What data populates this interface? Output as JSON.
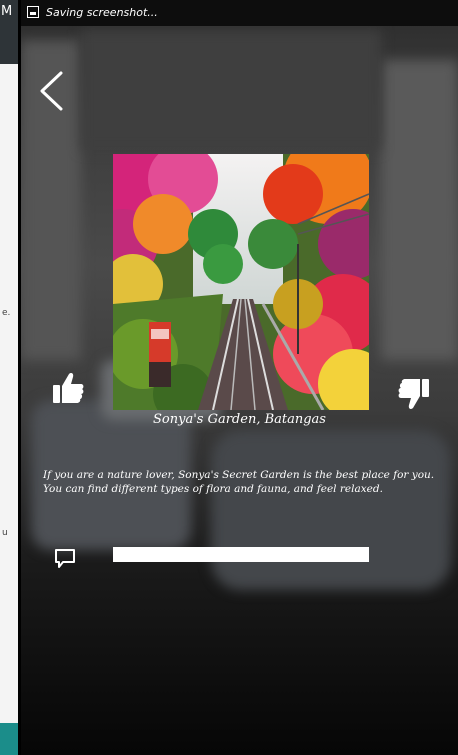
{
  "left_screen": {
    "top_letter": "M",
    "fragment_1": "e.",
    "fragment_2": "u"
  },
  "status_bar": {
    "notification": "Saving screenshot..."
  },
  "place": {
    "caption": "Sonya's Garden, Batangas",
    "description": "If you are a nature lover, Sonya's Secret Garden is the best place for you. You can find different types of flora and fauna, and feel relaxed."
  },
  "icons": {
    "back": "chevron-left-icon",
    "like": "thumbs-up-icon",
    "dislike": "thumbs-down-icon",
    "comment": "speech-bubble-icon",
    "screenshot": "image-icon"
  },
  "colors": {
    "teal_accent": "#1b8d8a"
  }
}
